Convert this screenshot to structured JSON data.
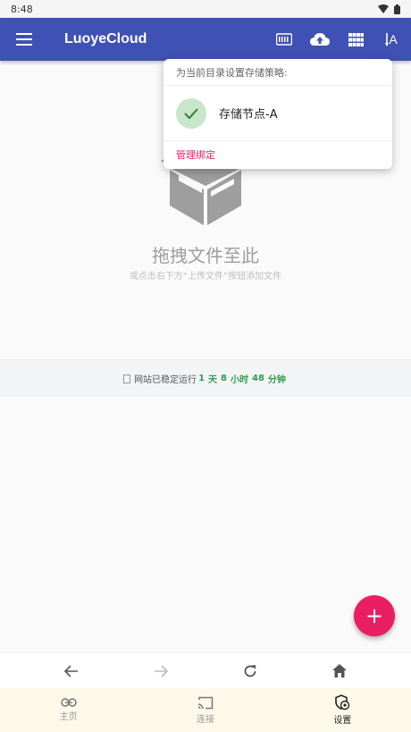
{
  "status_bar": {
    "time": "8:48"
  },
  "app_bar": {
    "title": "LuoyeCloud",
    "sort_label": "A"
  },
  "empty_state": {
    "title": "拖拽文件至此",
    "subtitle": "或点击右下方“上传文件”按钮添加文件"
  },
  "uptime": {
    "prefix": "网站已稳定运行",
    "days": "1",
    "days_unit": "天",
    "hours": "8",
    "hours_unit": "小时",
    "minutes": "48",
    "minutes_unit": "分钟"
  },
  "storage_popup": {
    "header": "为当前目录设置存储策略:",
    "item_label": "存储节点-A",
    "footer_link": "管理绑定"
  },
  "fab": {
    "label": "+"
  },
  "bottom_tabs": [
    {
      "label": "主页"
    },
    {
      "label": "连接"
    },
    {
      "label": "设置"
    }
  ],
  "colors": {
    "primary": "#3f51b5",
    "accent": "#e91e63",
    "success": "#2e9e4f"
  }
}
